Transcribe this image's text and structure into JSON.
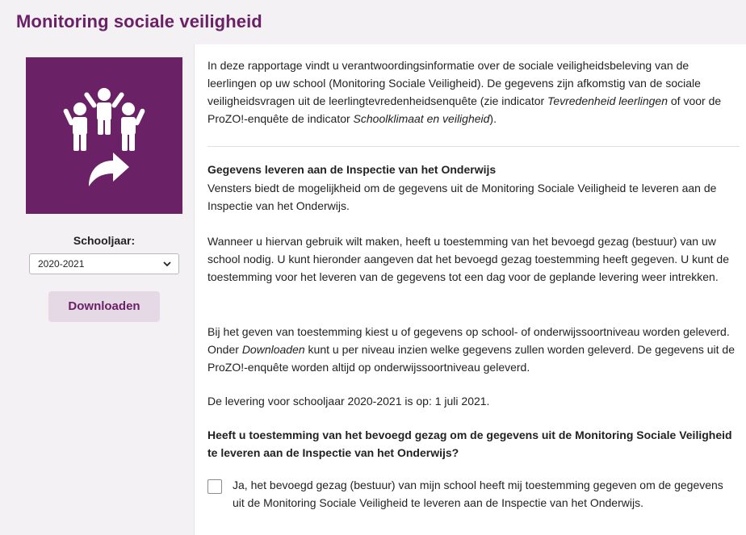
{
  "page": {
    "title": "Monitoring sociale veiligheid"
  },
  "sidebar": {
    "schoolyear_label": "Schooljaar:",
    "schoolyear_value": "2020-2021",
    "download_label": "Downloaden",
    "tile_icon": "children-share-icon"
  },
  "intro": {
    "part1": "In deze rapportage vindt u verantwoordingsinformatie over de sociale veiligheidsbeleving van de leerlingen op uw school (Monitoring Sociale Veiligheid). De gegevens zijn afkomstig van de sociale veiligheidsvragen uit de leerlingtevredenheidsenquête (zie indicator ",
    "italic1": "Tevredenheid leerlingen",
    "part2": " of voor de ProZO!-enquête de indicator ",
    "italic2": "Schoolklimaat en veiligheid",
    "part3": ")."
  },
  "section": {
    "heading": "Gegevens leveren aan de Inspectie van het Onderwijs",
    "p1": "Vensters biedt de mogelijkheid om de gegevens uit de Monitoring Sociale Veiligheid te leveren aan de Inspectie van het Onderwijs.",
    "p2": "Wanneer u hiervan gebruik wilt maken, heeft u toestemming van het bevoegd gezag (bestuur) van uw school nodig. U kunt hieronder aangeven dat het bevoegd gezag toestemming heeft gegeven. U kunt de toestemming voor het leveren van de gegevens tot een dag voor de geplande levering weer intrekken.",
    "p3_part1": "Bij het geven van toestemming kiest u of gegevens op school- of onderwijssoortniveau worden geleverd. Onder ",
    "p3_italic": "Downloaden",
    "p3_part2": " kunt u per niveau inzien welke gegevens zullen worden geleverd. De gegevens uit de ProZO!-enquête worden altijd op onderwijssoortniveau geleverd.",
    "p4": "De levering voor schooljaar 2020-2021 is op: 1 juli 2021.",
    "question": "Heeft u toestemming van het bevoegd gezag om de gegevens uit de Monitoring Sociale Veiligheid te leveren aan de Inspectie van het Onderwijs?",
    "checkbox_label": "Ja, het bevoegd gezag (bestuur) van mijn school heeft mij toestemming gegeven om de gegevens uit de Monitoring Sociale Veiligheid te leveren aan de Inspectie van het Onderwijs.",
    "checkbox_checked": false
  },
  "colors": {
    "brand": "#6b2166",
    "panel": "#f4f1f4",
    "button": "#e5d9e5"
  }
}
